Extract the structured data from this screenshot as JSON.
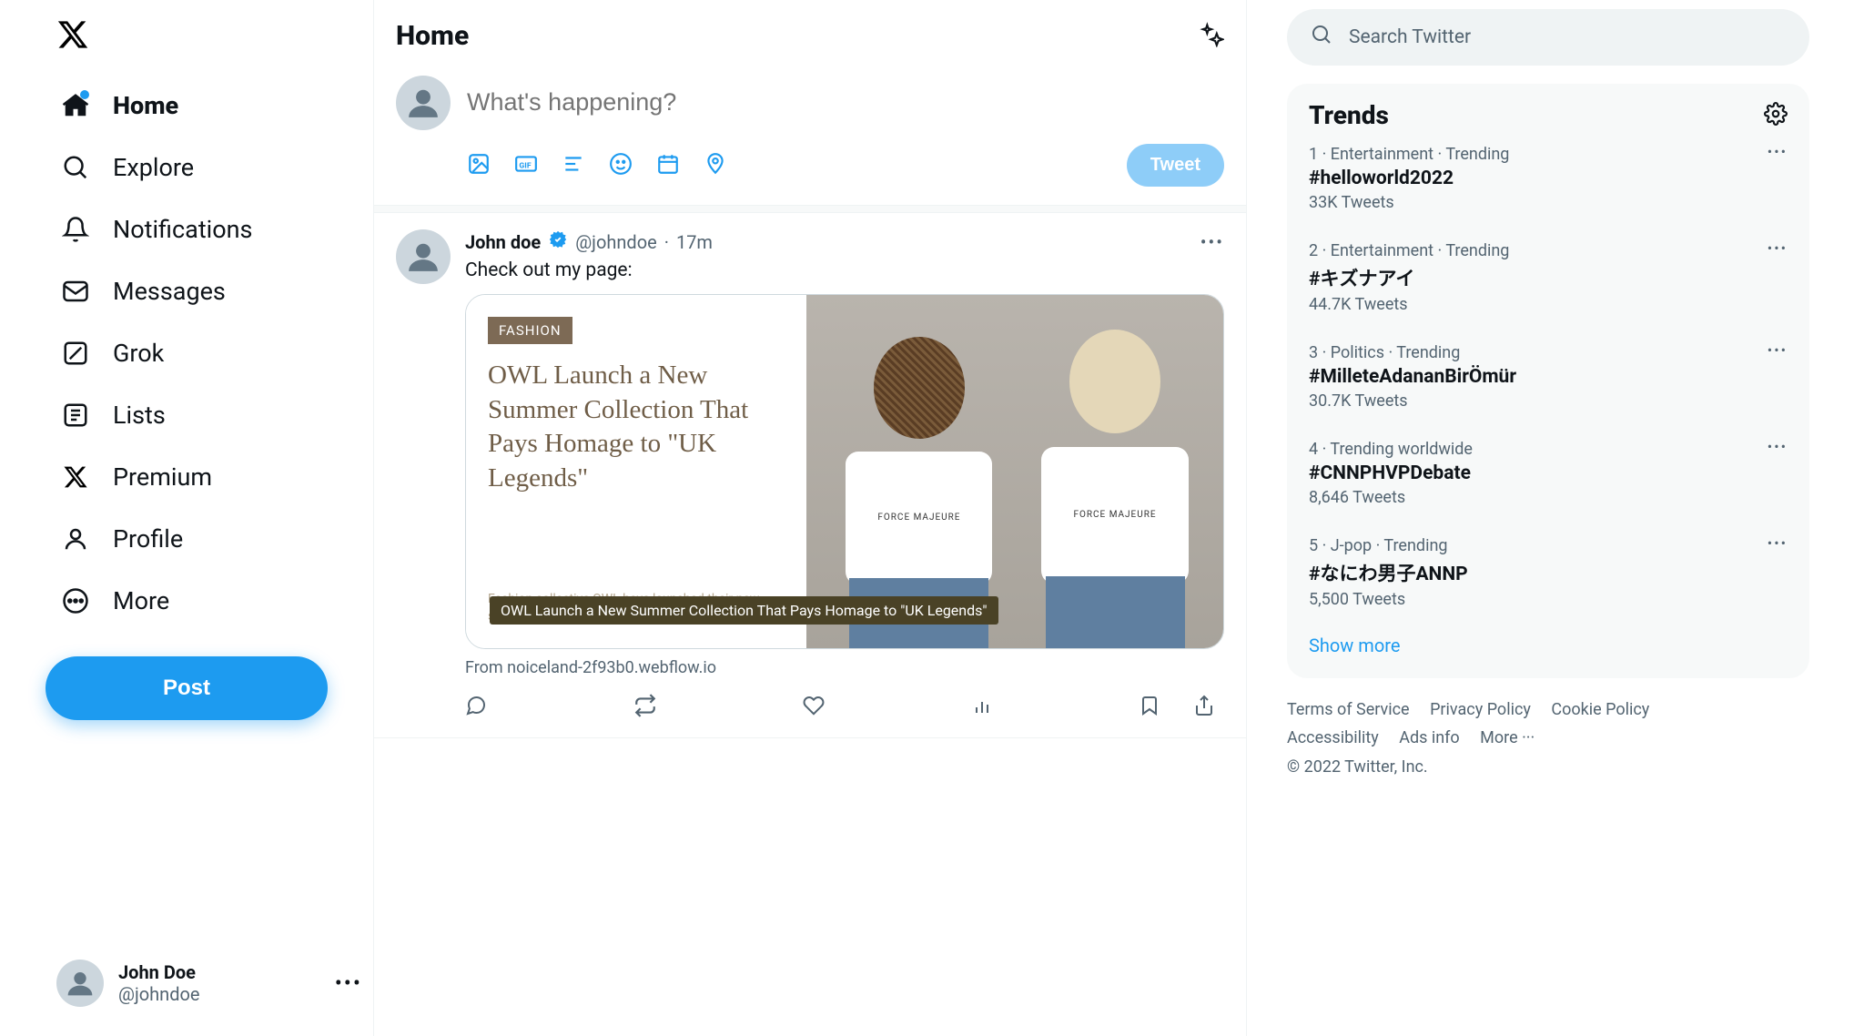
{
  "sidebar": {
    "items": [
      {
        "label": "Home",
        "icon": "home-icon"
      },
      {
        "label": "Explore",
        "icon": "search-icon"
      },
      {
        "label": "Notifications",
        "icon": "bell-icon"
      },
      {
        "label": "Messages",
        "icon": "mail-icon"
      },
      {
        "label": "Grok",
        "icon": "grok-icon"
      },
      {
        "label": "Lists",
        "icon": "list-icon"
      },
      {
        "label": "Premium",
        "icon": "x-icon"
      },
      {
        "label": "Profile",
        "icon": "person-icon"
      },
      {
        "label": "More",
        "icon": "more-circle-icon"
      }
    ],
    "post_label": "Post",
    "profile": {
      "display": "John Doe",
      "handle": "@johndoe"
    }
  },
  "header": {
    "title": "Home"
  },
  "composer": {
    "placeholder": "What's happening?",
    "tweet_label": "Tweet"
  },
  "tweet": {
    "name": "John doe",
    "handle": "@johndoe",
    "time": "17m",
    "text": "Check out my page:",
    "card": {
      "tag": "FASHION",
      "title": "OWL Launch a New Summer Collection That Pays Homage to \"UK Legends\"",
      "desc": "Fashion collective OWL have launched their new summer collection, which pays homage to",
      "overlay": "OWL Launch a New Summer Collection That Pays Homage to \"UK Legends\"",
      "shirt_text": "FORCE MAJEURE"
    },
    "source": "From noiceland-2f93b0.webflow.io"
  },
  "search": {
    "placeholder": "Search Twitter"
  },
  "trends": {
    "title": "Trends",
    "items": [
      {
        "meta": "1 · Entertainment · Trending",
        "tag": "#helloworld2022",
        "count": "33K Tweets"
      },
      {
        "meta": "2 · Entertainment · Trending",
        "tag": "#キズナアイ",
        "count": "44.7K Tweets"
      },
      {
        "meta": "3 · Politics · Trending",
        "tag": "#MilleteAdananBirÖmür",
        "count": "30.7K Tweets"
      },
      {
        "meta": "4 · Trending worldwide",
        "tag": "#CNNPHVPDebate",
        "count": "8,646 Tweets"
      },
      {
        "meta": "5 · J-pop · Trending",
        "tag": "#なにわ男子ANNP",
        "count": "5,500 Tweets"
      }
    ],
    "show_more": "Show more"
  },
  "footer": {
    "links": [
      "Terms of Service",
      "Privacy Policy",
      "Cookie Policy",
      "Accessibility",
      "Ads info",
      "More ···"
    ],
    "copyright": "© 2022 Twitter, Inc."
  }
}
